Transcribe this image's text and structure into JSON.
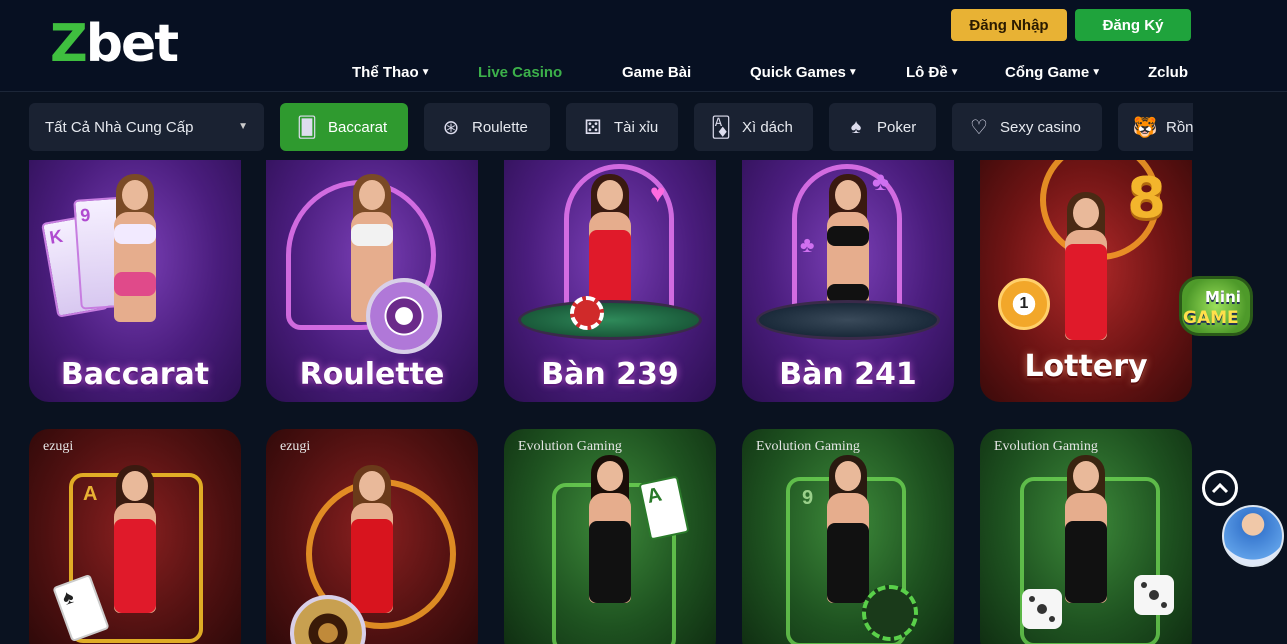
{
  "header": {
    "logo": "Zbet",
    "login_label": "Đăng Nhập",
    "register_label": "Đăng Ký",
    "nav": [
      {
        "label": "Thể Thao",
        "caret": true
      },
      {
        "label": "Live Casino",
        "caret": false,
        "active": true
      },
      {
        "label": "Game Bài",
        "caret": false
      },
      {
        "label": "Quick Games",
        "caret": true
      },
      {
        "label": "Lô Đề",
        "caret": true
      },
      {
        "label": "Cổng Game",
        "caret": true
      },
      {
        "label": "Zclub",
        "caret": false
      }
    ]
  },
  "filters": {
    "provider_select": "Tất Cả Nhà Cung Cấp",
    "chips": [
      {
        "label": "Baccarat",
        "icon": "cards-icon",
        "active": true
      },
      {
        "label": "Roulette",
        "icon": "roulette-icon"
      },
      {
        "label": "Tài xỉu",
        "icon": "dice-icon"
      },
      {
        "label": "Xì dách",
        "icon": "blackjack-icon"
      },
      {
        "label": "Poker",
        "icon": "poker-icon"
      },
      {
        "label": "Sexy casino",
        "icon": "sexy-icon"
      },
      {
        "label": "Rồng",
        "icon": "tiger-icon"
      }
    ]
  },
  "games_row1": [
    {
      "title": "Baccarat"
    },
    {
      "title": "Roulette"
    },
    {
      "title": "Bàn 239"
    },
    {
      "title": "Bàn 241"
    },
    {
      "title": "Lottery"
    }
  ],
  "games_row2": [
    {
      "provider": "ezugi"
    },
    {
      "provider": "ezugi"
    },
    {
      "provider": "Evolution Gaming"
    },
    {
      "provider": "Evolution Gaming"
    },
    {
      "provider": "Evolution Gaming"
    }
  ],
  "widgets": {
    "minigame_line1": "Mini",
    "minigame_line2": "GAME"
  },
  "colors": {
    "accent_green": "#2f9a2f",
    "login_yellow": "#e8b234",
    "active_nav": "#3cb04a",
    "background": "#0a1220"
  }
}
